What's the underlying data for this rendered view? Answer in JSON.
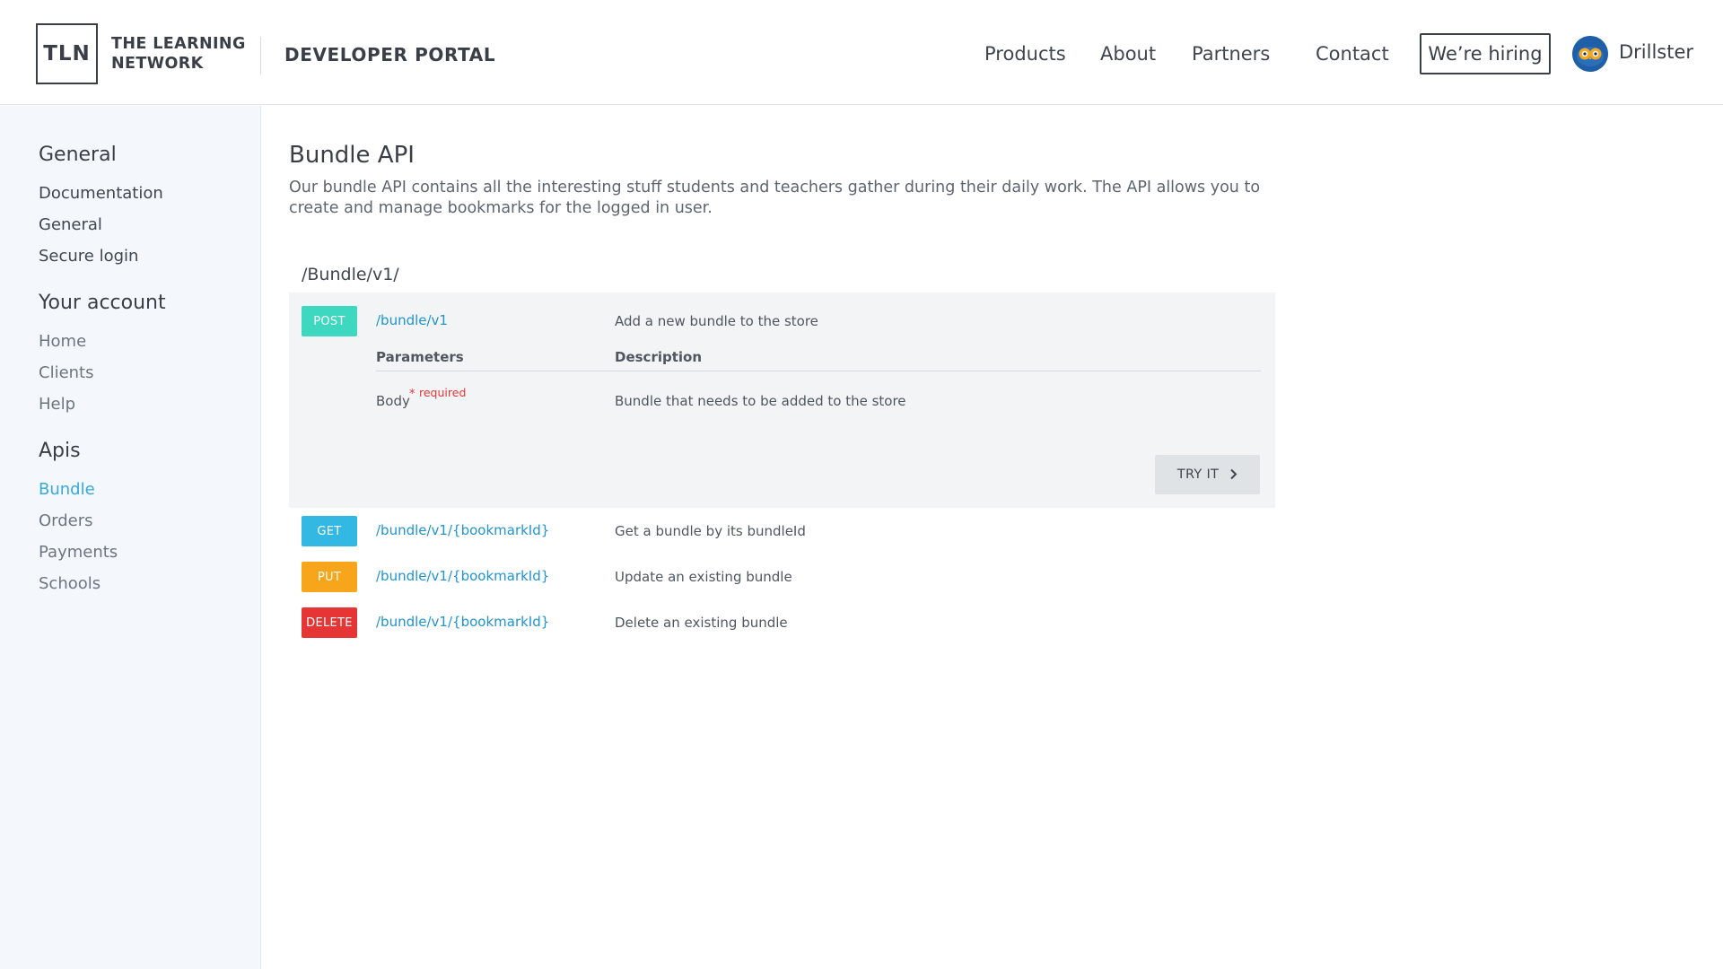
{
  "header": {
    "logo_mark": "TLN",
    "logo_line1": "THE LEARNING",
    "logo_line2": "NETWORK",
    "portal_title": "DEVELOPER PORTAL",
    "nav": {
      "products": "Products",
      "about": "About",
      "partners": "Partners",
      "contact": "Contact"
    },
    "hiring_label": "We’re hiring",
    "user_name": "Drillster",
    "avatar_icon": "owl-icon"
  },
  "sidebar": {
    "sections": [
      {
        "heading": "General",
        "items": [
          "Documentation",
          "General",
          "Secure login"
        ]
      },
      {
        "heading": "Your account",
        "items": [
          "Home",
          "Clients",
          "Help"
        ]
      },
      {
        "heading": "Apis",
        "items": [
          "Bundle",
          "Orders",
          "Payments",
          "Schools"
        ],
        "active_item": "Bundle"
      }
    ]
  },
  "main": {
    "title": "Bundle API",
    "description": "Our bundle API contains all the interesting stuff  students and teachers gather during their daily work. The API allows you to create and manage bookmarks for the logged in user.",
    "base_path": "/Bundle/v1/",
    "operations": [
      {
        "method": "POST",
        "path": "/bundle/v1",
        "description": "Add a new bundle to the store",
        "expanded": true
      },
      {
        "method": "GET",
        "path": "/bundle/v1/{bookmarkId}",
        "description": "Get a bundle by its bundleId",
        "expanded": false
      },
      {
        "method": "PUT",
        "path": "/bundle/v1/{bookmarkId}",
        "description": "Update an existing bundle",
        "expanded": false
      },
      {
        "method": "DELETE",
        "path": "/bundle/v1/{bookmarkId}",
        "description": "Delete an existing bundle",
        "expanded": false
      }
    ],
    "params_table": {
      "col_parameters": "Parameters",
      "col_description": "Description",
      "rows": [
        {
          "name": "Body",
          "required_marker": "*",
          "required_label": "required",
          "description": "Bundle that needs to be added to the store"
        }
      ]
    },
    "try_button_label": "TRY IT"
  },
  "colors": {
    "accent": "#35a9e0",
    "post": "#3ed8c0",
    "get": "#33b8e3",
    "put": "#f7a61b",
    "delete": "#e53535",
    "link": "#1f94d2"
  }
}
